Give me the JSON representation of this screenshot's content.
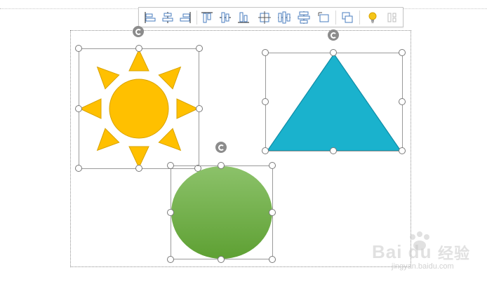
{
  "toolbar": {
    "buttons": [
      {
        "icon": "align-left-icon"
      },
      {
        "icon": "align-center-icon"
      },
      {
        "icon": "align-right-icon"
      },
      {
        "icon": "align-top-icon"
      },
      {
        "icon": "align-middle-icon"
      },
      {
        "icon": "align-bottom-icon"
      },
      {
        "icon": "align-both-center-icon"
      },
      {
        "icon": "distribute-horizontal-icon"
      },
      {
        "icon": "distribute-vertical-icon"
      },
      {
        "icon": "same-size-icon"
      },
      {
        "icon": "group-icon"
      },
      {
        "icon": "smart-tip-bulb-icon"
      },
      {
        "icon": "more-options-icon"
      }
    ]
  },
  "shapes": {
    "sun": {
      "name": "sun",
      "fill": "#FFC000",
      "stroke": "#D9A300"
    },
    "triangle": {
      "name": "triangle",
      "fill": "#1AB2CD",
      "stroke": "#0F8CA6"
    },
    "circle": {
      "name": "circle",
      "fill_top": "#8CC26A",
      "fill_bottom": "#5EA033"
    }
  },
  "watermark": {
    "brand": "Bai du",
    "service": "经验",
    "url": "jingyan.baidu.com"
  }
}
